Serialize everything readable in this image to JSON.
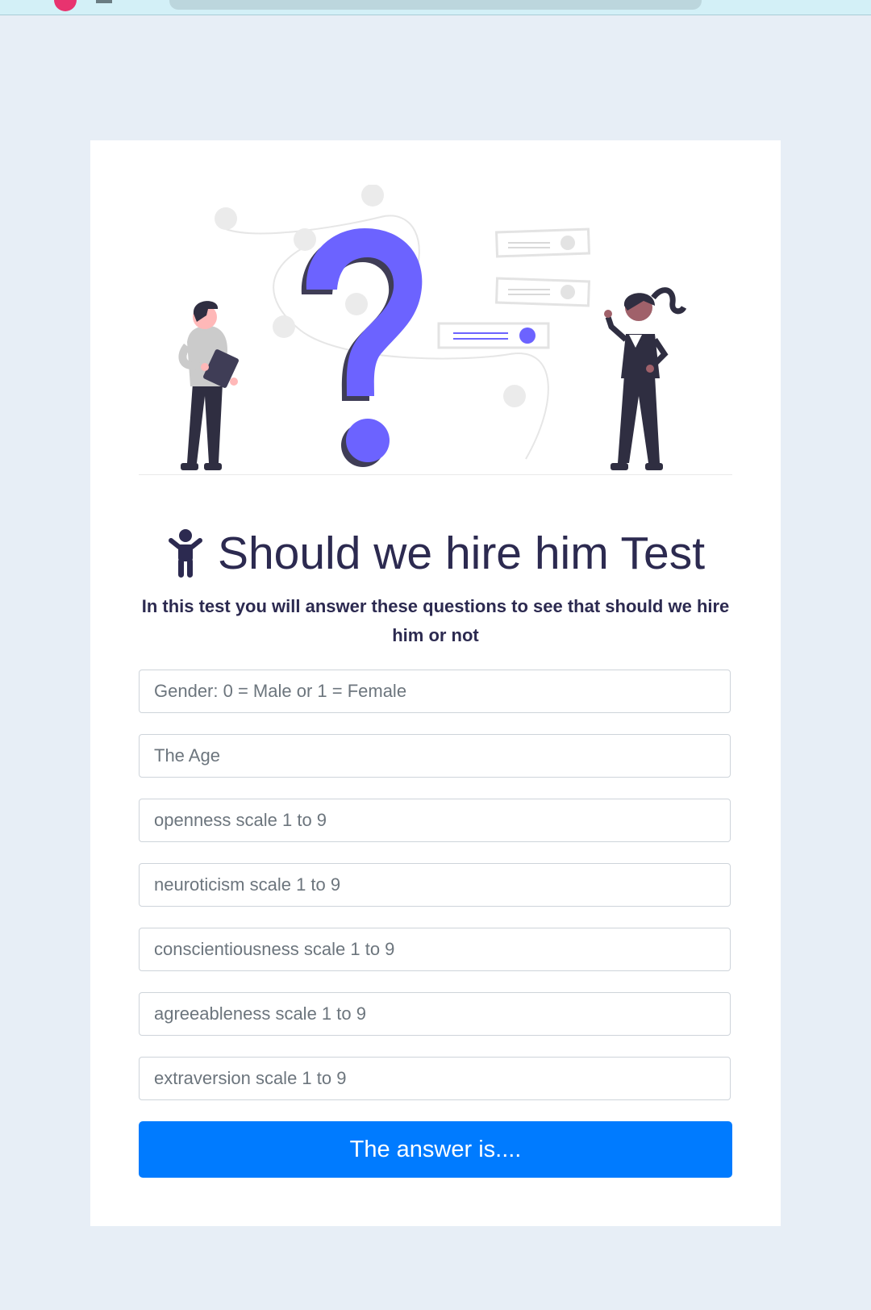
{
  "page": {
    "title": "Should we hire him Test",
    "title_icon": "child-icon",
    "subtitle": "In this test you will answer these questions to see that should we hire him or not"
  },
  "form": {
    "fields": [
      {
        "placeholder": "Gender: 0 = Male or 1 = Female",
        "value": ""
      },
      {
        "placeholder": "The Age",
        "value": ""
      },
      {
        "placeholder": "openness scale 1 to 9",
        "value": ""
      },
      {
        "placeholder": "neuroticism scale 1 to 9",
        "value": ""
      },
      {
        "placeholder": "conscientiousness scale 1 to 9",
        "value": ""
      },
      {
        "placeholder": "agreeableness scale 1 to 9",
        "value": ""
      },
      {
        "placeholder": "extraversion scale 1 to 9",
        "value": ""
      }
    ],
    "submit_label": "The answer is...."
  },
  "colors": {
    "page_background": "#e7eef6",
    "accent_purple": "#6c63ff",
    "heading": "#2c2a50",
    "button": "#007bff"
  }
}
